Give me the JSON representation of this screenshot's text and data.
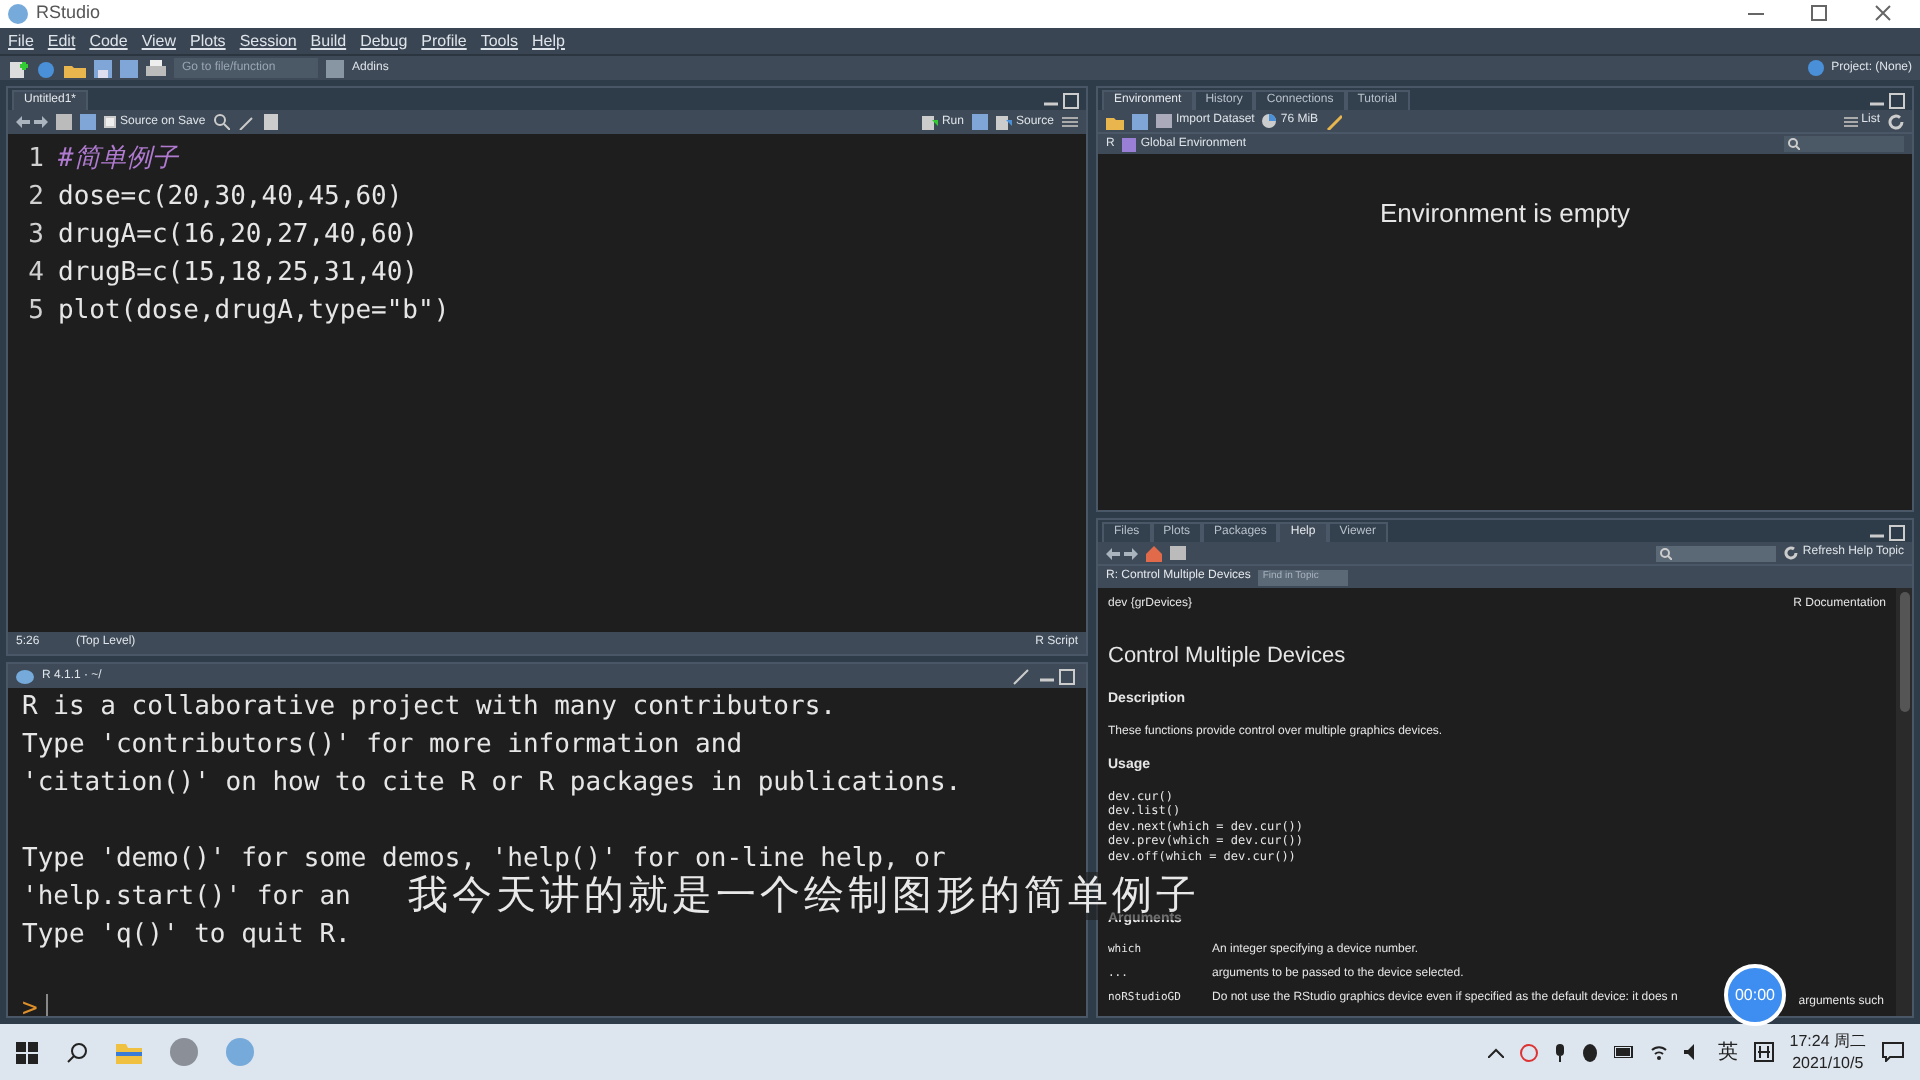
{
  "window": {
    "title": "RStudio"
  },
  "menu": [
    "File",
    "Edit",
    "Code",
    "View",
    "Plots",
    "Session",
    "Build",
    "Debug",
    "Profile",
    "Tools",
    "Help"
  ],
  "toolbar": {
    "goto_placeholder": "Go to file/function",
    "addins": "Addins",
    "project": "Project: (None)"
  },
  "editor": {
    "tabs": [
      {
        "label": "Untitled1*",
        "selected": true
      }
    ],
    "source_on_save": {
      "label": "Source on Save",
      "checked": false
    },
    "run": "Run",
    "source": "Source",
    "lines": [
      {
        "n": "1",
        "kind": "comment",
        "text": "#简单例子"
      },
      {
        "n": "2",
        "kind": "code",
        "text": "dose=c(20,30,40,45,60)"
      },
      {
        "n": "3",
        "kind": "code",
        "text": "drugA=c(16,20,27,40,60)"
      },
      {
        "n": "4",
        "kind": "code",
        "text": "drugB=c(15,18,25,31,40)"
      },
      {
        "n": "5",
        "kind": "code",
        "text": "plot(dose,drugA,type=\"b\")"
      }
    ],
    "status": {
      "position": "5:26",
      "scope": "(Top Level)",
      "type": "R Script"
    }
  },
  "console": {
    "title": "R 4.1.1 · ~/",
    "paragraphs": [
      [
        "R is a collaborative project with many contributors.",
        "Type 'contributors()' for more information and",
        "'citation()' on how to cite R or R packages in publications."
      ],
      [
        "Type 'demo()' for some demos, 'help()' for on-line help, or",
        "'help.start()' for an",
        "Type 'q()' to quit R."
      ]
    ],
    "prompt": ">"
  },
  "environment": {
    "tabs": [
      {
        "label": "Environment",
        "selected": true
      },
      {
        "label": "History",
        "selected": false
      },
      {
        "label": "Connections",
        "selected": false
      },
      {
        "label": "Tutorial",
        "selected": false
      }
    ],
    "import": "Import Dataset",
    "memory": "76 MiB",
    "list": "List",
    "lang": "R",
    "scope": "Global Environment",
    "empty": "Environment is empty"
  },
  "files": {
    "tabs": [
      {
        "label": "Files",
        "selected": false
      },
      {
        "label": "Plots",
        "selected": false
      },
      {
        "label": "Packages",
        "selected": false
      },
      {
        "label": "Help",
        "selected": true
      },
      {
        "label": "Viewer",
        "selected": false
      }
    ],
    "refresh": "Refresh Help Topic",
    "topic": "R: Control Multiple Devices",
    "find_placeholder": "Find in Topic",
    "help": {
      "package": "dev {grDevices}",
      "doc": "R Documentation",
      "title": "Control Multiple Devices",
      "description_heading": "Description",
      "description": "These functions provide control over multiple graphics devices.",
      "usage_heading": "Usage",
      "usage": [
        "dev.cur()",
        "dev.list()",
        "dev.next(which = dev.cur())",
        "dev.prev(which = dev.cur())",
        "dev.off(which = dev.cur())"
      ],
      "arguments_heading": "Arguments",
      "arguments": [
        {
          "name": "which",
          "text": "An integer specifying a device number."
        },
        {
          "name": "...",
          "text": "arguments to be passed to the device selected."
        },
        {
          "name": "noRStudioGD",
          "text": "Do not use the RStudio graphics device even if specified as the default device: it does n"
        }
      ],
      "trailing": "arguments such"
    }
  },
  "subtitle": "我今天讲的就是一个绘制图形的简单例子",
  "timer": "00:00",
  "taskbar": {
    "ime": "英",
    "time": "17:24 周二",
    "date": "2021/10/5"
  }
}
